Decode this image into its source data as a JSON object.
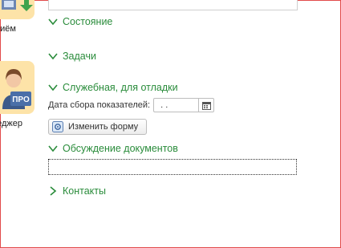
{
  "side_panel": {
    "tiles": [
      {
        "label": "риём"
      },
      {
        "label": "неджер"
      }
    ]
  },
  "sections": {
    "state": {
      "title": "Состояние",
      "expanded": true
    },
    "tasks": {
      "title": "Задачи",
      "expanded": true
    },
    "debug": {
      "title": "Служебная, для отладки",
      "expanded": true,
      "date_label": "Дата сбора показателей:",
      "date_value": ". .",
      "edit_form_label": "Изменить форму"
    },
    "docs_discussion": {
      "title": "Обсуждение документов",
      "expanded": true,
      "value": ""
    },
    "contacts": {
      "title": "Контакты",
      "expanded": false
    }
  },
  "colors": {
    "accent_green": "#2a8c3b",
    "tile_bg": "#fde3a8",
    "frame_red": "#e24a4a"
  }
}
